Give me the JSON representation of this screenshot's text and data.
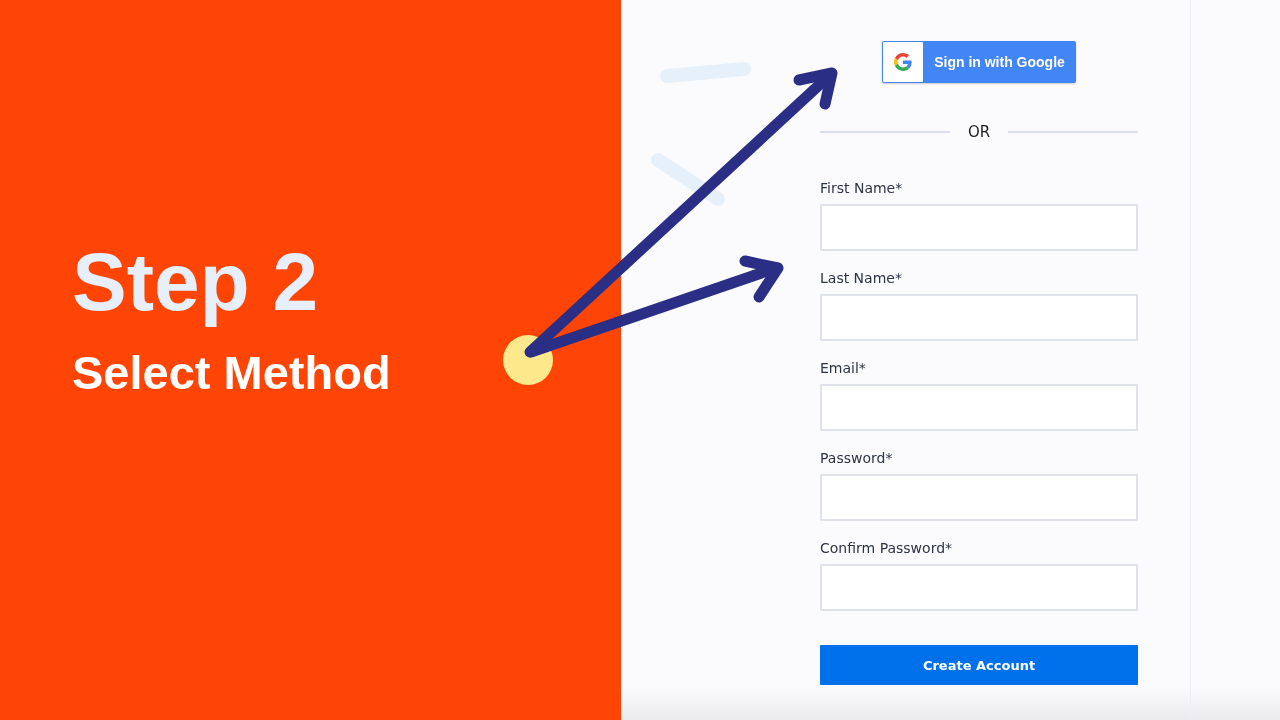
{
  "intro": {
    "title": "Step 2",
    "subtitle": "Select Method"
  },
  "signup_form": {
    "google_button": "Sign in with Google",
    "divider": "OR",
    "fields": [
      {
        "label": "First Name*"
      },
      {
        "label": "Last Name*"
      },
      {
        "label": "Email*"
      },
      {
        "label": "Password*"
      },
      {
        "label": "Confirm Password*"
      }
    ],
    "submit_button": "Create Account"
  }
}
